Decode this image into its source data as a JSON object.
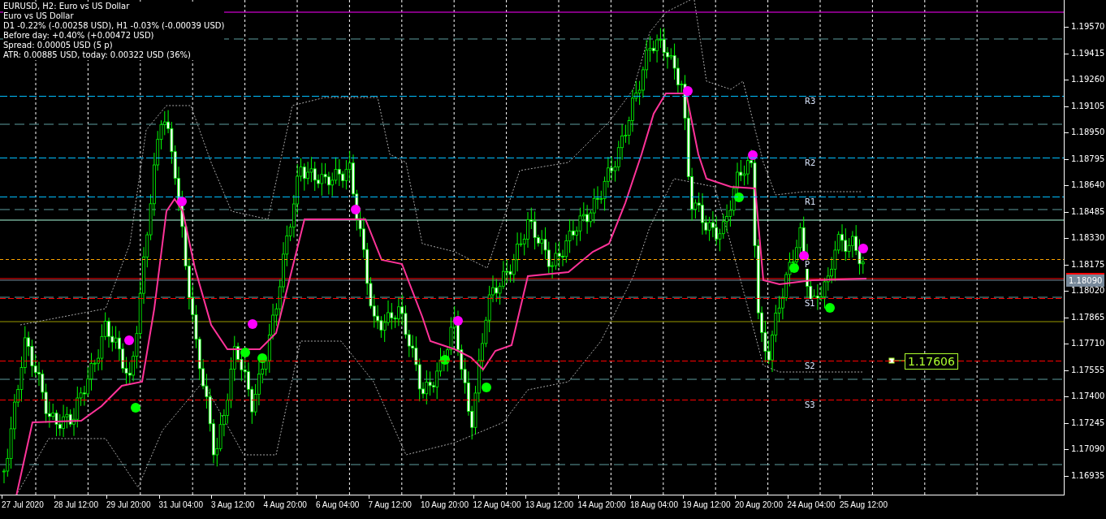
{
  "info": {
    "title": "EURUSD, H2:  Euro vs US Dollar",
    "lines": [
      "Euro vs US Dollar",
      "D1 -0.22% (-0.00258 USD), H1 -0.03% (-0.00039 USD)",
      "Before day: +0.40% (+0.00472 USD)",
      "Spread: 0.00005 USD (5 p)",
      "ATR: 0.00885 USD, today: 0.00322 USD (36%)"
    ]
  },
  "levels": [
    {
      "label": "R3",
      "kind": "resistance",
      "color": "#00bfff"
    },
    {
      "label": "R2",
      "kind": "resistance",
      "color": "#00bfff"
    },
    {
      "label": "R1",
      "kind": "resistance",
      "color": "#00bfff"
    },
    {
      "label": "P",
      "kind": "pivot",
      "color": "#ffa500"
    },
    {
      "label": "S1",
      "kind": "support",
      "color": "#ff0000"
    },
    {
      "label": "S2",
      "kind": "support",
      "color": "#ff0000"
    },
    {
      "label": "S3",
      "kind": "support",
      "color": "#ff0000"
    }
  ],
  "price_marker": {
    "label": "1.17606"
  },
  "price_axis": {
    "current_price": "1.18090",
    "ticks": [
      "1.19570",
      "1.19415",
      "1.19260",
      "1.19105",
      "1.18950",
      "1.18795",
      "1.18640",
      "1.18485",
      "1.18330",
      "1.18175",
      "1.18020",
      "1.17865",
      "1.17710",
      "1.17555",
      "1.17400",
      "1.17245",
      "1.17090",
      "1.16935"
    ]
  },
  "time_axis": {
    "ticks": [
      "27 Jul 2020",
      "28 Jul 12:00",
      "29 Jul 20:00",
      "31 Jul 04:00",
      "3 Aug 12:00",
      "4 Aug 20:00",
      "6 Aug 04:00",
      "7 Aug 12:00",
      "10 Aug 20:00",
      "12 Aug 04:00",
      "13 Aug 12:00",
      "14 Aug 20:00",
      "18 Aug 04:00",
      "19 Aug 12:00",
      "20 Aug 20:00",
      "24 Aug 04:00",
      "25 Aug 12:00"
    ]
  }
}
